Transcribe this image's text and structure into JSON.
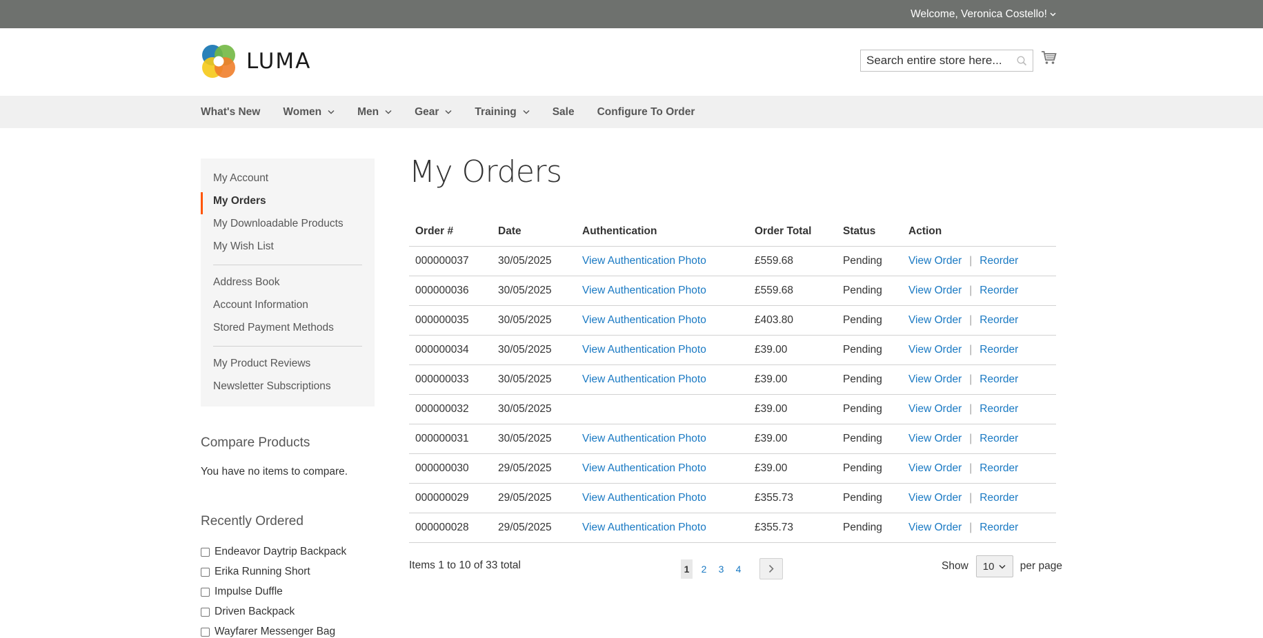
{
  "top_bar": {
    "welcome": "Welcome, Veronica Costello!"
  },
  "header": {
    "logo_text": "LUMA",
    "search_placeholder": "Search entire store here..."
  },
  "nav": {
    "items": [
      {
        "label": "What's New",
        "has_dropdown": false
      },
      {
        "label": "Women",
        "has_dropdown": true
      },
      {
        "label": "Men",
        "has_dropdown": true
      },
      {
        "label": "Gear",
        "has_dropdown": true
      },
      {
        "label": "Training",
        "has_dropdown": true
      },
      {
        "label": "Sale",
        "has_dropdown": false
      },
      {
        "label": "Configure To Order",
        "has_dropdown": false
      }
    ]
  },
  "sidebar": {
    "items": [
      {
        "label": "My Account"
      },
      {
        "label": "My Orders",
        "active": true
      },
      {
        "label": "My Downloadable Products"
      },
      {
        "label": "My Wish List"
      },
      {
        "label": "Address Book"
      },
      {
        "label": "Account Information"
      },
      {
        "label": "Stored Payment Methods"
      },
      {
        "label": "My Product Reviews"
      },
      {
        "label": "Newsletter Subscriptions"
      }
    ]
  },
  "compare": {
    "title": "Compare Products",
    "empty_text": "You have no items to compare."
  },
  "recently_ordered": {
    "title": "Recently Ordered",
    "items": [
      "Endeavor Daytrip Backpack",
      "Erika Running Short",
      "Impulse Duffle",
      "Driven Backpack",
      "Wayfarer Messenger Bag"
    ]
  },
  "main": {
    "title": "My Orders",
    "columns": [
      "Order #",
      "Date",
      "Authentication",
      "Order Total",
      "Status",
      "Action"
    ],
    "rows": [
      {
        "order": "000000037",
        "date": "30/05/2025",
        "auth": "View Authentication Photo",
        "total": "£559.68",
        "status": "Pending",
        "view": "View Order",
        "reorder": "Reorder"
      },
      {
        "order": "000000036",
        "date": "30/05/2025",
        "auth": "View Authentication Photo",
        "total": "£559.68",
        "status": "Pending",
        "view": "View Order",
        "reorder": "Reorder"
      },
      {
        "order": "000000035",
        "date": "30/05/2025",
        "auth": "View Authentication Photo",
        "total": "£403.80",
        "status": "Pending",
        "view": "View Order",
        "reorder": "Reorder"
      },
      {
        "order": "000000034",
        "date": "30/05/2025",
        "auth": "View Authentication Photo",
        "total": "£39.00",
        "status": "Pending",
        "view": "View Order",
        "reorder": "Reorder"
      },
      {
        "order": "000000033",
        "date": "30/05/2025",
        "auth": "View Authentication Photo",
        "total": "£39.00",
        "status": "Pending",
        "view": "View Order",
        "reorder": "Reorder"
      },
      {
        "order": "000000032",
        "date": "30/05/2025",
        "auth": "",
        "total": "£39.00",
        "status": "Pending",
        "view": "View Order",
        "reorder": "Reorder"
      },
      {
        "order": "000000031",
        "date": "30/05/2025",
        "auth": "View Authentication Photo",
        "total": "£39.00",
        "status": "Pending",
        "view": "View Order",
        "reorder": "Reorder"
      },
      {
        "order": "000000030",
        "date": "29/05/2025",
        "auth": "View Authentication Photo",
        "total": "£39.00",
        "status": "Pending",
        "view": "View Order",
        "reorder": "Reorder"
      },
      {
        "order": "000000029",
        "date": "29/05/2025",
        "auth": "View Authentication Photo",
        "total": "£355.73",
        "status": "Pending",
        "view": "View Order",
        "reorder": "Reorder"
      },
      {
        "order": "000000028",
        "date": "29/05/2025",
        "auth": "View Authentication Photo",
        "total": "£355.73",
        "status": "Pending",
        "view": "View Order",
        "reorder": "Reorder"
      }
    ],
    "action_separator": "|"
  },
  "toolbar": {
    "amount": "Items 1 to 10 of 33 total",
    "pages": [
      "1",
      "2",
      "3",
      "4"
    ],
    "current_page": "1",
    "show_label": "Show",
    "limit_value": "10",
    "per_page_label": "per page"
  },
  "colors": {
    "top_bar": "#6e716e",
    "link": "#1979c3",
    "active_accent": "#ff5501",
    "nav_bg": "#f0f0f0"
  }
}
